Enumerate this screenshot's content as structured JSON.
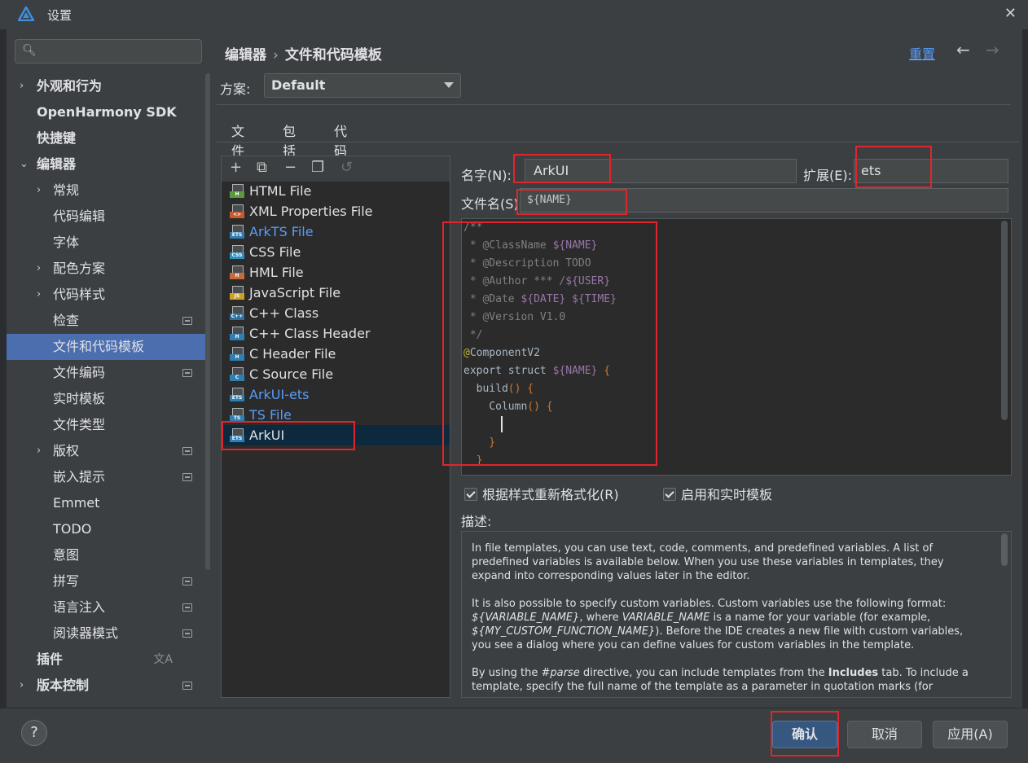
{
  "window": {
    "title": "设置"
  },
  "sidebar": {
    "search_placeholder": "",
    "items": [
      {
        "label": "外观和行为",
        "level": 0,
        "arrow": "›"
      },
      {
        "label": "OpenHarmony SDK",
        "level": 0
      },
      {
        "label": "快捷键",
        "level": 0
      },
      {
        "label": "编辑器",
        "level": 0,
        "arrow": "⌄"
      },
      {
        "label": "常规",
        "level": 1,
        "arrow": "›"
      },
      {
        "label": "代码编辑",
        "level": 1
      },
      {
        "label": "字体",
        "level": 1
      },
      {
        "label": "配色方案",
        "level": 1,
        "arrow": "›"
      },
      {
        "label": "代码样式",
        "level": 1,
        "arrow": "›"
      },
      {
        "label": "检查",
        "level": 1,
        "mark": true
      },
      {
        "label": "文件和代码模板",
        "level": 1,
        "selected": true
      },
      {
        "label": "文件编码",
        "level": 1,
        "mark": true
      },
      {
        "label": "实时模板",
        "level": 1
      },
      {
        "label": "文件类型",
        "level": 1
      },
      {
        "label": "版权",
        "level": 1,
        "arrow": "›",
        "mark": true
      },
      {
        "label": "嵌入提示",
        "level": 1,
        "mark": true
      },
      {
        "label": "Emmet",
        "level": 1
      },
      {
        "label": "TODO",
        "level": 1
      },
      {
        "label": "意图",
        "level": 1
      },
      {
        "label": "拼写",
        "level": 1,
        "mark": true
      },
      {
        "label": "语言注入",
        "level": 1,
        "mark": true
      },
      {
        "label": "阅读器模式",
        "level": 1,
        "mark": true
      },
      {
        "label": "插件",
        "level": 0,
        "translate_icon": "文A"
      },
      {
        "label": "版本控制",
        "level": 0,
        "arrow": "›",
        "mark": true
      }
    ]
  },
  "header": {
    "breadcrumb": [
      "编辑器",
      "文件和代码模板"
    ],
    "breadcrumb_sep": "›",
    "reset": "重置",
    "back": "←",
    "forward": "→"
  },
  "scheme": {
    "label": "方案:",
    "value": "Default"
  },
  "tabs": [
    {
      "label": "文件",
      "active": true
    },
    {
      "label": "包括"
    },
    {
      "label": "代码"
    }
  ],
  "toolbar": {
    "add": "+",
    "add_copy": "⧉",
    "remove": "−",
    "copy": "❐",
    "undo": "↺"
  },
  "files": [
    {
      "name": "HTML File",
      "tag": "H",
      "tag_color": "#5a9a3c"
    },
    {
      "name": "XML Properties File",
      "tag": "<>",
      "tag_color": "#c85a2f"
    },
    {
      "name": "ArkTS File",
      "tag": "ETS",
      "tag_color": "#2f7fb3",
      "blue": true
    },
    {
      "name": "CSS File",
      "tag": "CSS",
      "tag_color": "#2f8fbf"
    },
    {
      "name": "HML File",
      "tag": "H",
      "tag_color": "#c8693a"
    },
    {
      "name": "JavaScript File",
      "tag": "JS",
      "tag_color": "#c9a227"
    },
    {
      "name": "C++ Class",
      "tag": "C++",
      "tag_color": "#2f6f9f"
    },
    {
      "name": "C++ Class Header",
      "tag": "H",
      "tag_color": "#2f7fb3"
    },
    {
      "name": "C Header File",
      "tag": "H",
      "tag_color": "#2f7fb3"
    },
    {
      "name": "C Source File",
      "tag": "C",
      "tag_color": "#2f7fb3"
    },
    {
      "name": "ArkUI-ets",
      "tag": "ETS",
      "tag_color": "#2f7fb3",
      "blue": true
    },
    {
      "name": "TS File",
      "tag": "TS",
      "tag_color": "#2f7fb3",
      "blue": true
    },
    {
      "name": "ArkUI",
      "tag": "ETS",
      "tag_color": "#2f7fb3",
      "selected": true
    }
  ],
  "form": {
    "name_label": "名字(N):",
    "name_value": "ArkUI",
    "ext_label": "扩展(E):",
    "ext_value": "ets",
    "filename_label": "文件名(S):",
    "filename_value": "${NAME}"
  },
  "code": [
    [
      {
        "t": "/**",
        "c": "com"
      }
    ],
    [
      {
        "t": " * @ClassName ",
        "c": "com"
      },
      {
        "t": "${NAME}",
        "c": "var"
      }
    ],
    [
      {
        "t": " * @Description TODO",
        "c": "com"
      }
    ],
    [
      {
        "t": " * @Author *** /",
        "c": "com"
      },
      {
        "t": "${USER}",
        "c": "var"
      }
    ],
    [
      {
        "t": " * @Date ",
        "c": "com"
      },
      {
        "t": "${DATE}",
        "c": "var"
      },
      {
        "t": " ",
        "c": "com"
      },
      {
        "t": "${TIME}",
        "c": "var"
      }
    ],
    [
      {
        "t": " * @Version V1.0",
        "c": "com"
      }
    ],
    [
      {
        "t": " */",
        "c": "com"
      }
    ],
    [
      {
        "t": "@",
        "c": "ann"
      },
      {
        "t": "ComponentV2",
        "c": "plain"
      }
    ],
    [
      {
        "t": "export struct ",
        "c": "plain"
      },
      {
        "t": "${NAME}",
        "c": "var"
      },
      {
        "t": " {",
        "c": "kw"
      }
    ],
    [
      {
        "t": "  build",
        "c": "plain"
      },
      {
        "t": "() {",
        "c": "kw"
      }
    ],
    [
      {
        "t": "    Column",
        "c": "plain"
      },
      {
        "t": "() {",
        "c": "kw"
      }
    ],
    [
      {
        "t": "",
        "c": "plain"
      }
    ],
    [
      {
        "t": "    }",
        "c": "kw"
      }
    ],
    [
      {
        "t": "  }",
        "c": "kw"
      }
    ]
  ],
  "options": {
    "reformat": "根据样式重新格式化(R)",
    "live_templates": "启用和实时模板"
  },
  "description": {
    "label": "描述:",
    "p1": "In file templates, you can use text, code, comments, and predefined variables. A list of predefined variables is available below. When you use these variables in templates, they expand into corresponding values later in the editor.",
    "p2a": "It is also possible to specify custom variables. Custom variables use the following format: ",
    "p2b": "${VARIABLE_NAME}",
    "p2c": ", where ",
    "p2d": "VARIABLE_NAME",
    "p2e": " is a name for your variable (for example, ",
    "p2f": "${MY_CUSTOM_FUNCTION_NAME}",
    "p2g": "). Before the IDE creates a new file with custom variables, you see a dialog where you can define values for custom variables in the template.",
    "p3a": "By using the ",
    "p3b": "#parse",
    "p3c": " directive, you can include templates from the ",
    "p3d": "Includes",
    "p3e": " tab. To include a template, specify the full name of the template as a parameter in quotation marks (for"
  },
  "footer": {
    "help": "?",
    "ok": "确认",
    "cancel": "取消",
    "apply": "应用(A)"
  },
  "colors": {
    "accent": "#4b6eaf",
    "annotation_red": "#e0262c",
    "link": "#589df6"
  }
}
